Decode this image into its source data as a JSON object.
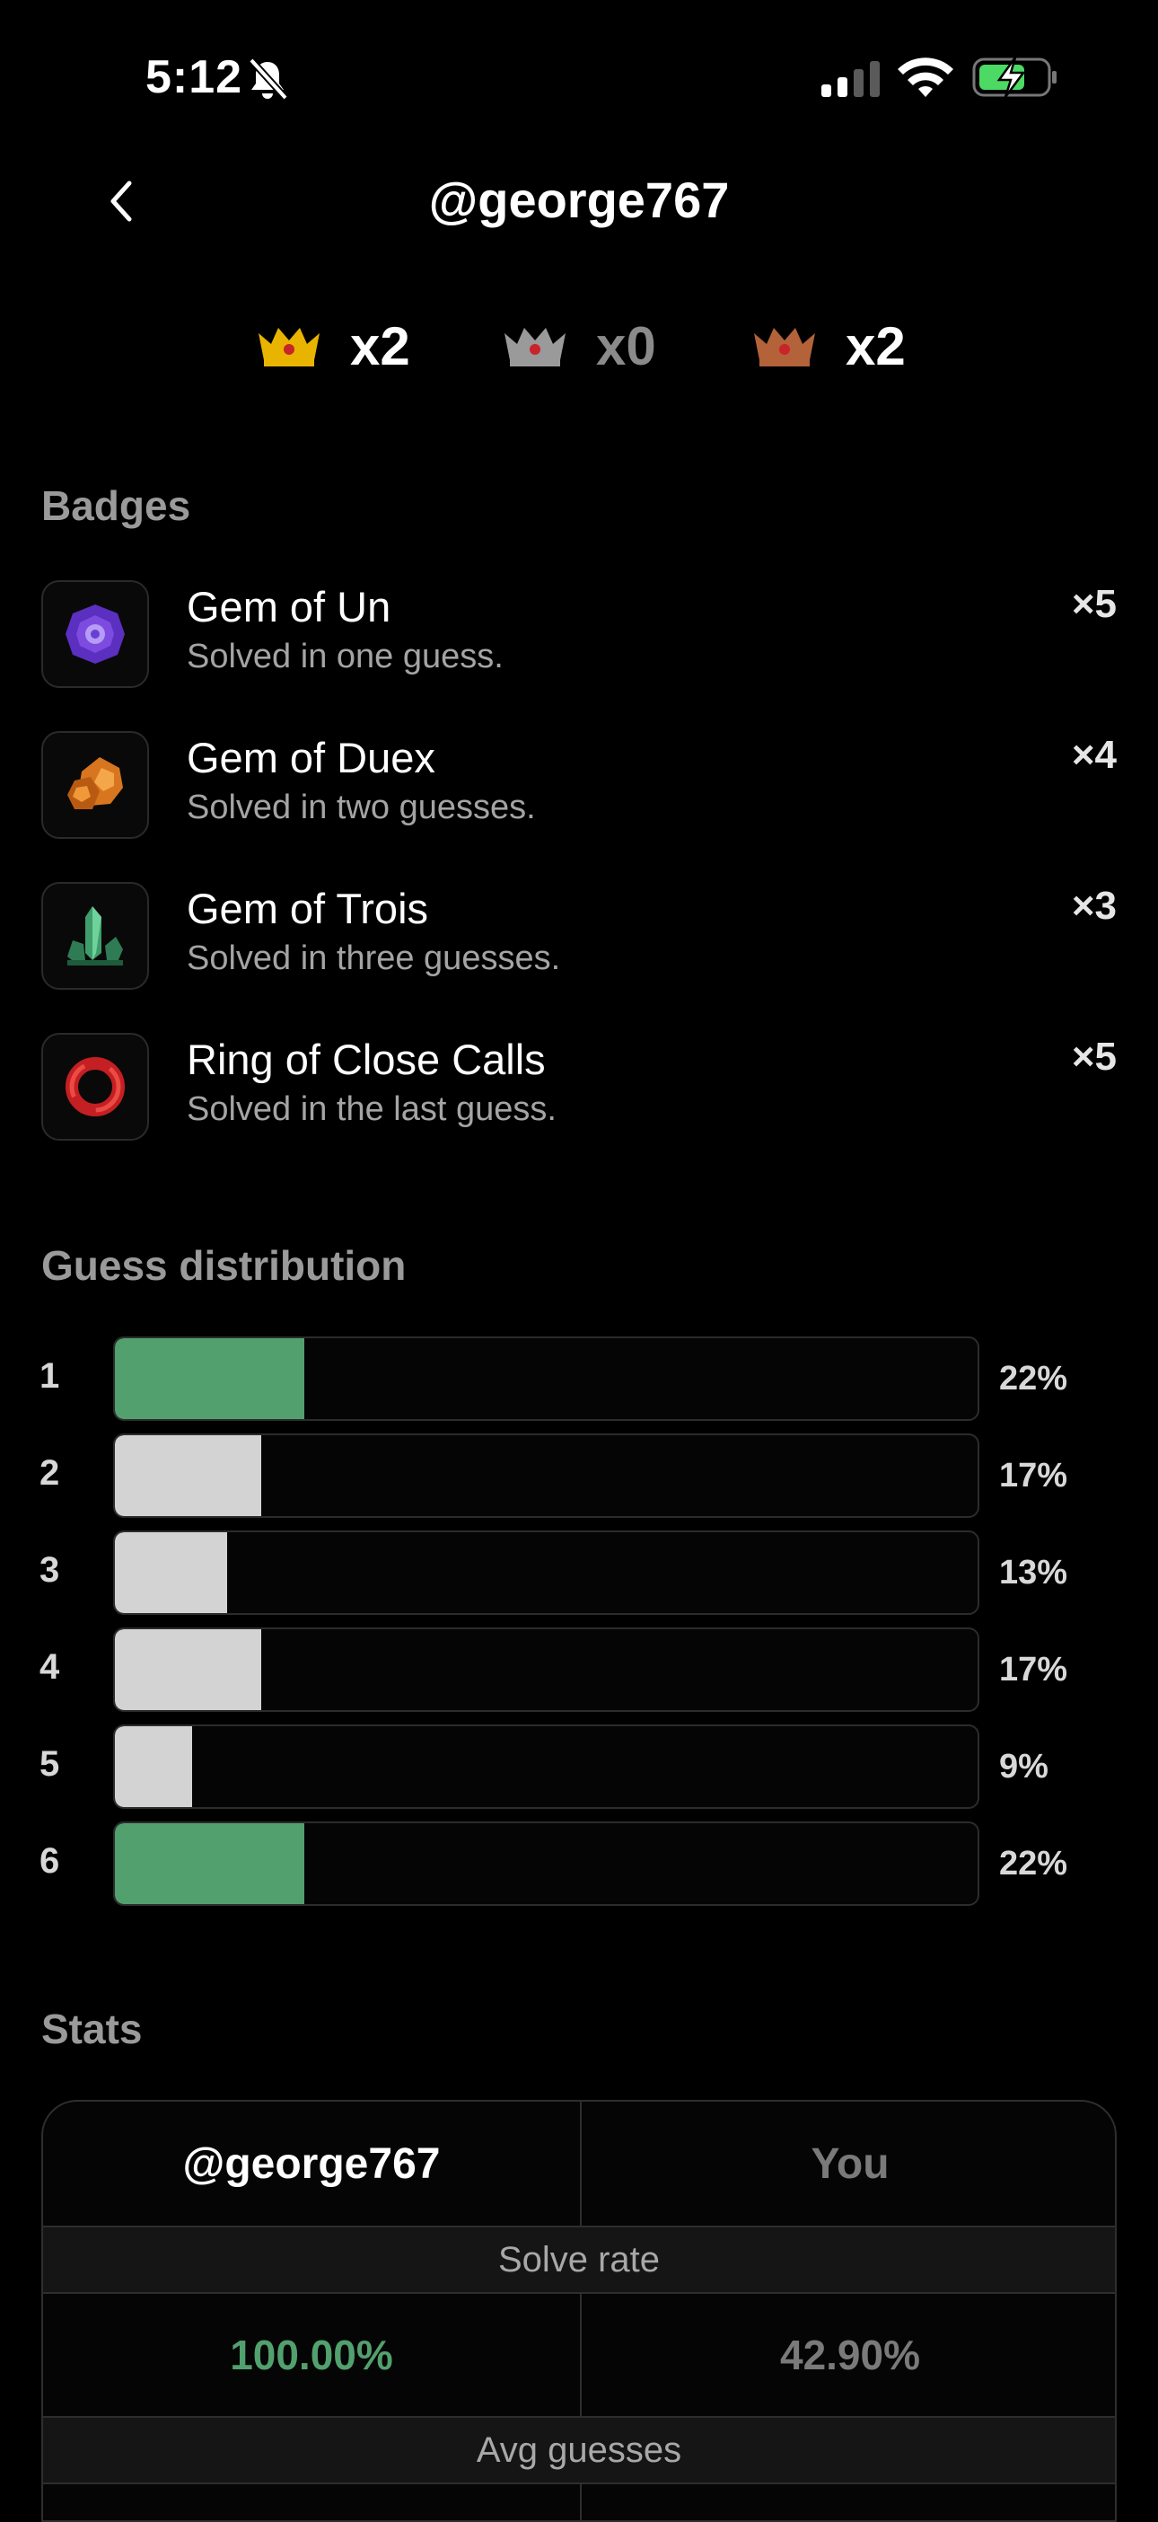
{
  "status_bar": {
    "time": "5:12"
  },
  "header": {
    "title": "@george767"
  },
  "crowns": [
    {
      "type": "gold",
      "count": "x2",
      "color": "#ffffff"
    },
    {
      "type": "silver",
      "count": "x0",
      "color": "#8a8a8a"
    },
    {
      "type": "bronze",
      "count": "x2",
      "color": "#ffffff"
    }
  ],
  "badges": {
    "title": "Badges",
    "items": [
      {
        "name": "Gem of Un",
        "description": "Solved in one guess.",
        "count": "×5",
        "icon": "purple-gem-icon"
      },
      {
        "name": "Gem of Duex",
        "description": "Solved in two guesses.",
        "count": "×4",
        "icon": "orange-gem-icon"
      },
      {
        "name": "Gem of Trois",
        "description": "Solved in three guesses.",
        "count": "×3",
        "icon": "green-crystal-icon"
      },
      {
        "name": "Ring of Close Calls",
        "description": "Solved in the last guess.",
        "count": "×5",
        "icon": "red-ring-icon"
      }
    ]
  },
  "distribution": {
    "title": "Guess distribution",
    "rows": [
      {
        "guess": "1",
        "percent": "22%",
        "value": 22,
        "highlight": true
      },
      {
        "guess": "2",
        "percent": "17%",
        "value": 17,
        "highlight": false
      },
      {
        "guess": "3",
        "percent": "13%",
        "value": 13,
        "highlight": false
      },
      {
        "guess": "4",
        "percent": "17%",
        "value": 17,
        "highlight": false
      },
      {
        "guess": "5",
        "percent": "9%",
        "value": 9,
        "highlight": false
      },
      {
        "guess": "6",
        "percent": "22%",
        "value": 22,
        "highlight": true
      }
    ],
    "colors": {
      "highlight": "#52a06e",
      "normal": "#d3d3d3"
    }
  },
  "stats": {
    "title": "Stats",
    "columns": [
      "@george767",
      "You"
    ],
    "metrics": [
      {
        "label": "Solve rate",
        "values": [
          "100.00%",
          "42.90%"
        ]
      },
      {
        "label": "Avg guesses",
        "values": [
          "",
          ""
        ]
      }
    ],
    "colors": {
      "accent": "#52a06e",
      "muted": "#7a7a7a"
    }
  }
}
